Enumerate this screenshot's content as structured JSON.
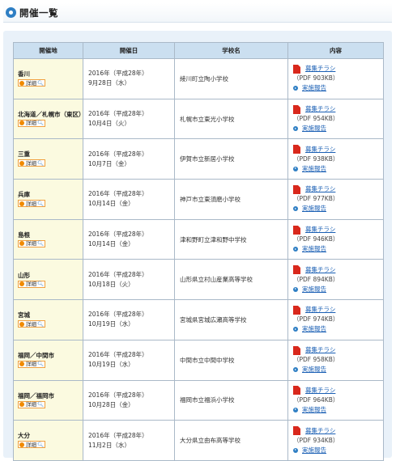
{
  "page": {
    "title": "開催一覧"
  },
  "table": {
    "headers": [
      "開催地",
      "開催日",
      "学校名",
      "内容"
    ],
    "detail_label": "詳細",
    "flyer_label": "募集チラシ",
    "report_label": "実施報告",
    "rows": [
      {
        "pref": "香川",
        "date1": "2016年（平成28年）",
        "date2": "9月28日（水）",
        "school": "綾川町立陶小学校",
        "size": "（PDF 903KB）"
      },
      {
        "pref": "北海道／札幌市（東区）",
        "date1": "2016年（平成28年）",
        "date2": "10月4日（火）",
        "school": "札幌市立東光小学校",
        "size": "（PDF 954KB）"
      },
      {
        "pref": "三重",
        "date1": "2016年（平成28年）",
        "date2": "10月7日（金）",
        "school": "伊賀市立新居小学校",
        "size": "（PDF 938KB）"
      },
      {
        "pref": "兵庫",
        "date1": "2016年（平成28年）",
        "date2": "10月14日（金）",
        "school": "神戸市立東須磨小学校",
        "size": "（PDF 977KB）"
      },
      {
        "pref": "島根",
        "date1": "2016年（平成28年）",
        "date2": "10月14日（金）",
        "school": "津和野町立津和野中学校",
        "size": "（PDF 946KB）"
      },
      {
        "pref": "山形",
        "date1": "2016年（平成28年）",
        "date2": "10月18日（火）",
        "school": "山形県立村山産業高等学校",
        "size": "（PDF 894KB）"
      },
      {
        "pref": "宮城",
        "date1": "2016年（平成28年）",
        "date2": "10月19日（水）",
        "school": "宮城県宮城広瀬高等学校",
        "size": "（PDF 974KB）"
      },
      {
        "pref": "福岡／中間市",
        "date1": "2016年（平成28年）",
        "date2": "10月19日（水）",
        "school": "中間市立中間中学校",
        "size": "（PDF 958KB）"
      },
      {
        "pref": "福岡／福岡市",
        "date1": "2016年（平成28年）",
        "date2": "10月28日（金）",
        "school": "福岡市立福浜小学校",
        "size": "（PDF 964KB）"
      },
      {
        "pref": "大分",
        "date1": "2016年（平成28年）",
        "date2": "11月2日（水）",
        "school": "大分県立由布高等学校",
        "size": "（PDF 934KB）"
      }
    ]
  }
}
